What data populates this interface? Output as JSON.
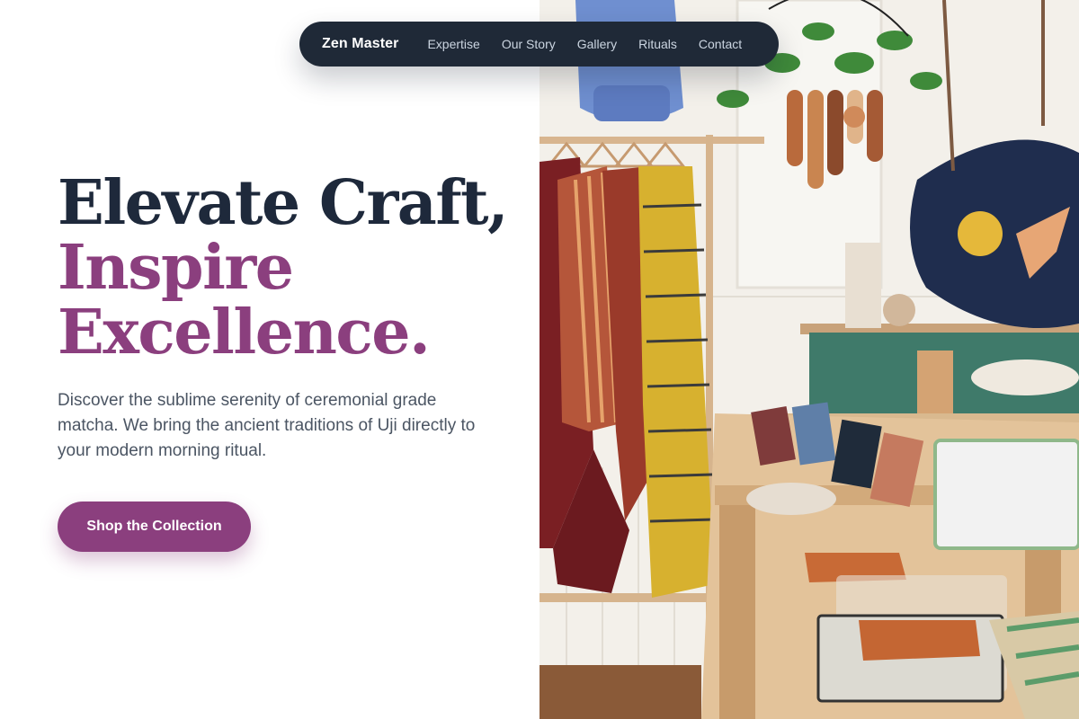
{
  "nav": {
    "brand": "Zen Master",
    "links": [
      "Expertise",
      "Our Story",
      "Gallery",
      "Rituals",
      "Contact"
    ]
  },
  "hero": {
    "headline_line1": "Elevate Craft,",
    "headline_line2": "Inspire",
    "headline_line3": "Excellence.",
    "subcopy": "Discover the sublime serenity of ceremonial grade matcha. We bring the ancient traditions of Uji directly to your modern morning ritual.",
    "cta_label": "Shop the Collection"
  },
  "colors": {
    "accent": "#8b3f7e",
    "heading_dark": "#1e293b",
    "nav_bg": "#1f2937",
    "body_text": "#4b5563"
  },
  "hero_image": {
    "subject": "boutique-interior-photo"
  }
}
